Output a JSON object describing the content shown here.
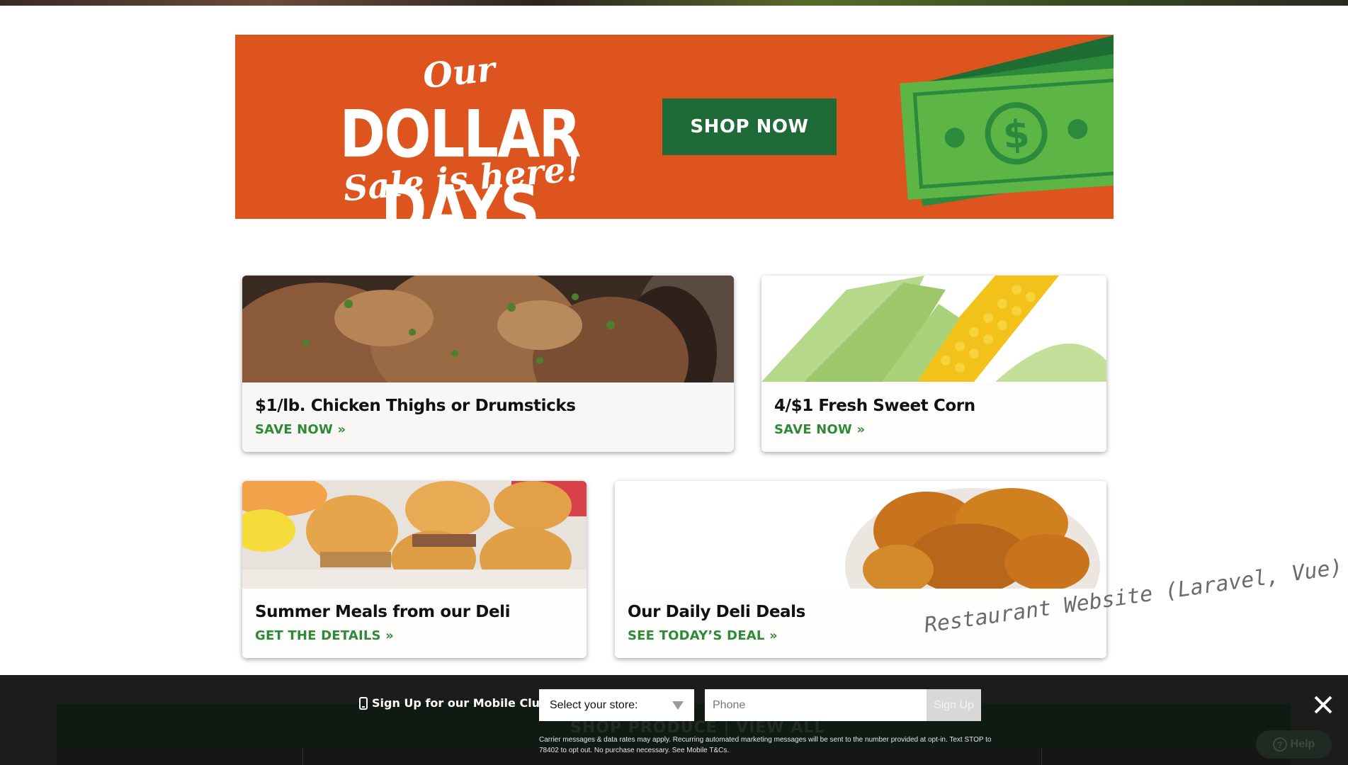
{
  "banner": {
    "our": "Our",
    "headline": "DOLLAR DAYS",
    "sale": "Sale is here!",
    "shop_now": "SHOP NOW",
    "colors": {
      "background": "#de541e",
      "button": "#1f6b38",
      "cash": "#5cb544"
    }
  },
  "cards": [
    {
      "title": "$1/lb. Chicken Thighs or Drumsticks",
      "cta": "SAVE NOW »",
      "image": "roasted-chicken"
    },
    {
      "title": "4/$1 Fresh Sweet Corn",
      "cta": "SAVE NOW »",
      "image": "sweet-corn"
    },
    {
      "title": "Summer Meals from our Deli",
      "cta": "GET THE DETAILS »",
      "image": "deli-sliders"
    },
    {
      "title": "Our Daily Deli Deals",
      "cta": "SEE TODAY’S DEAL »",
      "image": "fried-chicken"
    }
  ],
  "accent_color": "#2f8a38",
  "watermark": "Restaurant Website (Laravel, Vue)",
  "mobile_club": {
    "label": "Sign Up for our Mobile Club",
    "label_icon": "mobile-phone-icon",
    "store_select": "Select your store:",
    "phone_placeholder": "Phone",
    "signup_button": "Sign Up",
    "disclaimer": "Carrier messages & data rates may apply. Recurring automated marketing messages will be sent to the number provided at opt-in. Text STOP to 78402 to opt out. No purchase necessary. See Mobile T&Cs.",
    "close_icon": "close-icon"
  },
  "background_strip": {
    "text": "SHOP PRODUCE  |  VIEW ALL"
  },
  "help_button": {
    "label": "Help",
    "icon": "question-icon"
  }
}
